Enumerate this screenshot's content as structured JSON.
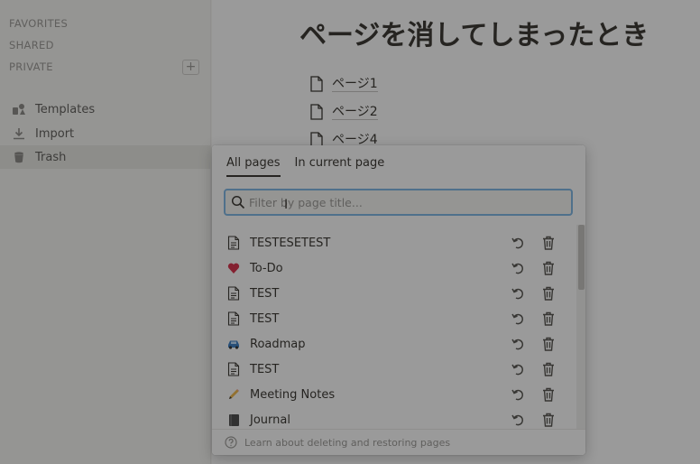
{
  "sidebar": {
    "sections": {
      "favorites": "FAVORITES",
      "shared": "SHARED",
      "private": "PRIVATE"
    },
    "add_label": "+",
    "items": [
      {
        "label": "Templates",
        "icon": "templates-icon"
      },
      {
        "label": "Import",
        "icon": "import-icon"
      },
      {
        "label": "Trash",
        "icon": "trash-icon"
      }
    ]
  },
  "main": {
    "title": "ページを消してしまったとき",
    "links": [
      "ページ1",
      "ページ2",
      "ページ4"
    ]
  },
  "trash_popup": {
    "tabs": [
      "All pages",
      "In current page"
    ],
    "search": {
      "placeholder": "Filter by page title...",
      "value": ""
    },
    "items": [
      {
        "label": "TESTESETEST",
        "icon": "page-icon"
      },
      {
        "label": "To-Do",
        "icon": "heart-emoji-icon"
      },
      {
        "label": "TEST",
        "icon": "page-icon"
      },
      {
        "label": "TEST",
        "icon": "page-icon"
      },
      {
        "label": "Roadmap",
        "icon": "car-emoji-icon"
      },
      {
        "label": "TEST",
        "icon": "page-icon"
      },
      {
        "label": "Meeting Notes",
        "icon": "pencil-emoji-icon"
      },
      {
        "label": "Journal",
        "icon": "notebook-emoji-icon"
      }
    ],
    "footer": "Learn about deleting and restoring pages"
  }
}
